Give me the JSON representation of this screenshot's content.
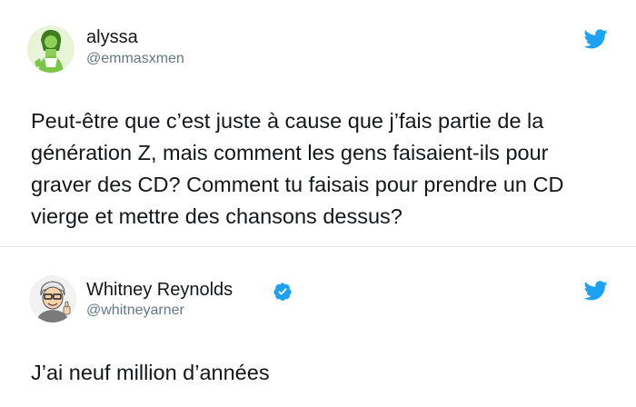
{
  "tweets": [
    {
      "display_name": "alyssa",
      "handle": "@emmasxmen",
      "verified": false,
      "avatar_icon": "avatar-green-character",
      "text": "Peut-être que c’est juste à cause que j’fais partie de la génération Z, mais comment les gens faisaient-ils pour graver des CD? Comment tu faisais pour prendre un CD vierge et mettre des chansons dessus?"
    },
    {
      "display_name": "Whitney Reynolds",
      "handle": "@whitneyarner",
      "verified": true,
      "avatar_icon": "avatar-cartoon-man-thumbs-up",
      "text": "J’ai neuf million d’années"
    }
  ],
  "colors": {
    "twitter_blue": "#1da1f2",
    "text": "#14171a",
    "handle": "#657786",
    "divider": "#e1e8ed"
  },
  "icons": [
    "twitter-bird-icon",
    "verified-badge-icon"
  ]
}
